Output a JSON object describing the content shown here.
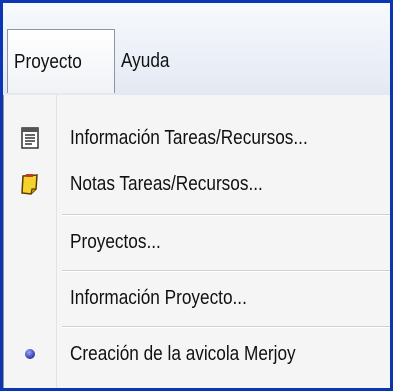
{
  "menubar": {
    "items": [
      {
        "label": "Proyecto",
        "active": true
      },
      {
        "label": "Ayuda",
        "active": false
      }
    ]
  },
  "menu": {
    "items": [
      {
        "label": "Información Tareas/Recursos...",
        "icon": "task-info-icon"
      },
      {
        "label": "Notas Tareas/Recursos...",
        "icon": "notes-icon"
      },
      {
        "label": "Proyectos..."
      },
      {
        "label": "Información Proyecto..."
      },
      {
        "label": "Creación de la avicola Merjoy",
        "icon": "radio-bullet-icon",
        "selected": true
      }
    ]
  },
  "colors": {
    "frame": "#0a36b4",
    "menu_bg": "#f5f5f5",
    "bullet": "#2a2f9e"
  }
}
